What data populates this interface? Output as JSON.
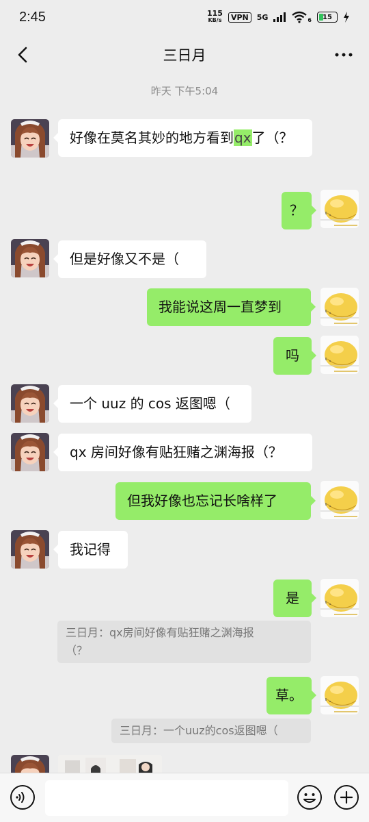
{
  "status_bar": {
    "time": "2:45",
    "speed_value": "115",
    "speed_unit": "KB/s",
    "vpn": "VPN",
    "network": "5G",
    "wifi_level": "6",
    "battery": "15"
  },
  "header": {
    "title": "三日月"
  },
  "timestamp": "昨天 下午5:04",
  "messages": [
    {
      "side": "left",
      "text_before": "好像在莫名其妙的地方看到",
      "highlight": "qx",
      "text_after": "了（？"
    },
    {
      "side": "right",
      "text": "？"
    },
    {
      "side": "left",
      "text": "但是好像又不是（"
    },
    {
      "side": "right",
      "text": "我能说这周一直梦到"
    },
    {
      "side": "right",
      "text": "吗"
    },
    {
      "side": "left",
      "text": "一个 uuz 的 cos 返图嗯（"
    },
    {
      "side": "left",
      "text": "qx 房间好像有贴狂赌之渊海报（？"
    },
    {
      "side": "right",
      "text": "但我好像也忘记长啥样了"
    },
    {
      "side": "left",
      "text": "我记得"
    },
    {
      "side": "right",
      "text": "是"
    },
    {
      "side": "right",
      "text": "草。"
    }
  ],
  "quotes": [
    {
      "text_line1": "三日月：qx房间好像有贴狂赌之渊海报",
      "text_line2": "（？"
    },
    {
      "text": "三日月：一个uuz的cos返图嗯（"
    }
  ],
  "input": {
    "placeholder": ""
  },
  "colors": {
    "background": "#ededed",
    "sent_bubble": "#95ec69",
    "received_bubble": "#ffffff"
  }
}
